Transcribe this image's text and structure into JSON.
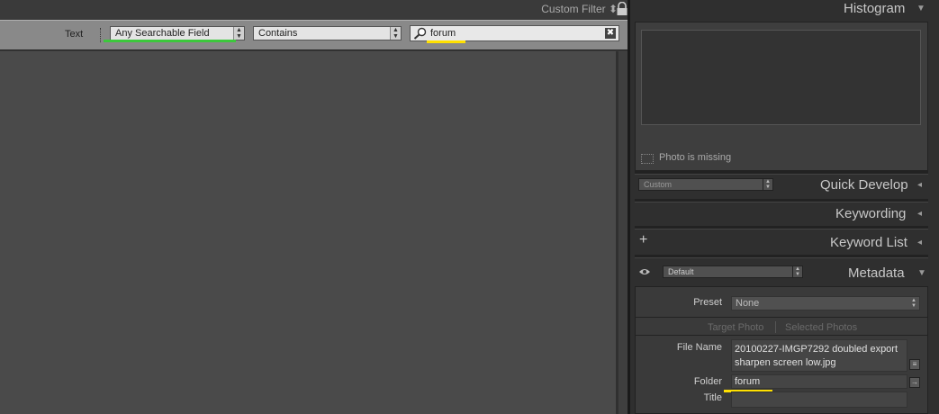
{
  "top": {
    "custom_filter": "Custom Filter ⬍"
  },
  "filter_bar": {
    "text_label": "Text",
    "field_dropdown": "Any Searchable Field",
    "rule_dropdown": "Contains",
    "search_value": "forum",
    "clear_glyph": "✖",
    "dropdown_arrow": "▲\n▼",
    "field_underline_color": "#3cc83c",
    "search_underline_color": "#ffe000"
  },
  "histogram": {
    "title": "Histogram",
    "collapse": "▼",
    "missing_text": "Photo is missing"
  },
  "quick_develop": {
    "preset": "Custom",
    "title": "Quick Develop",
    "toggle": "◂"
  },
  "keywording": {
    "title": "Keywording",
    "toggle": "◂"
  },
  "keyword_list": {
    "add": "+",
    "title": "Keyword List",
    "toggle": "◂"
  },
  "metadata": {
    "eye": "👁",
    "view_preset": "Default",
    "title": "Metadata",
    "collapse": "▼",
    "preset_label": "Preset",
    "preset_value": "None",
    "target_photo": "Target Photo",
    "selected_photos": "Selected Photos",
    "file_name_label": "File Name",
    "file_name_line1": "20100227-IMGP7292 doubled export",
    "file_name_line2": "sharpen screen low.jpg",
    "folder_label": "Folder",
    "folder_value": "forum",
    "folder_underline_color": "#ffe000",
    "title_label": "Title",
    "list_glyph": "≡",
    "goto_glyph": "→"
  }
}
